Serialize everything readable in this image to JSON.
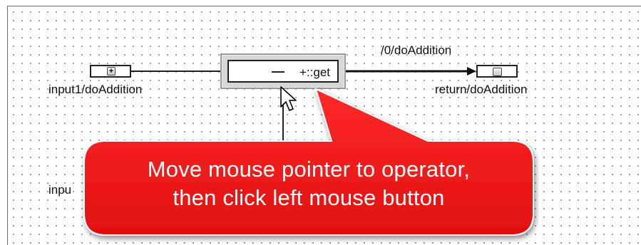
{
  "canvas": {
    "input1_label": "input1/doAddition",
    "input2_label": "inpu",
    "return_label": "return/doAddition",
    "path_label": "/0/doAddition",
    "input_port_glyph": "+"
  },
  "operator": {
    "label": "+::get"
  },
  "callout": {
    "line1": "Move mouse pointer to operator,",
    "line2": "then click left mouse button",
    "color": "#ee1c24"
  },
  "icons": {
    "cursor": "mouse-pointer-icon"
  }
}
